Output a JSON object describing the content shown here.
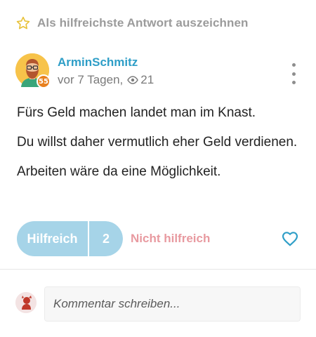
{
  "best_answer": {
    "label": "Als hilfreichste Antwort auszeichnen",
    "icon": "star-outline-icon",
    "color": "#e8c23a"
  },
  "author": {
    "name": "ArminSchmitz",
    "level": "55",
    "time": "vor 7 Tagen,",
    "views": "21",
    "name_color": "#2e9ec7"
  },
  "answer": {
    "paragraphs": [
      "Fürs Geld machen landet man im Knast.",
      "Du willst daher vermutlich eher Geld verdienen.",
      "Arbeiten wäre da eine Möglichkeit."
    ]
  },
  "votes": {
    "helpful_label": "Hilfreich",
    "helpful_count": "2",
    "not_helpful_label": "Nicht hilfreich",
    "helpful_color": "#a6d4e8",
    "not_helpful_color": "#e89aa0"
  },
  "comment": {
    "placeholder": "Kommentar schreiben..."
  }
}
